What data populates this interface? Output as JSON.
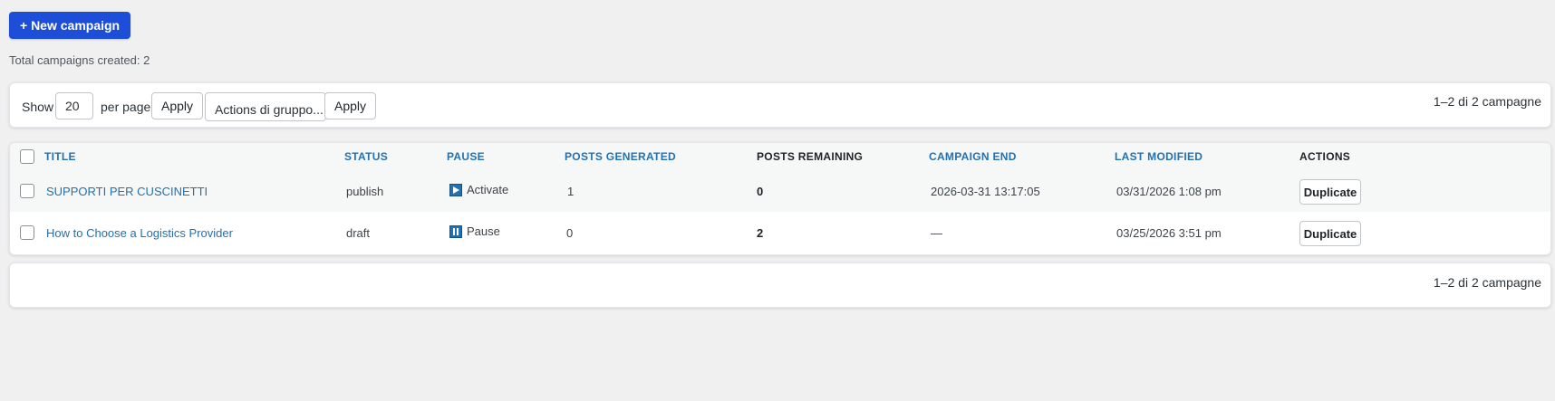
{
  "header": {
    "new_campaign_label": "+ New campaign",
    "total_text": "Total campaigns created: 2"
  },
  "toolbar": {
    "show_label": "Show",
    "per_page_value": "20",
    "per_page_label": "per page",
    "apply_label": "Apply",
    "bulk_actions_label": "Actions di gruppo...",
    "bulk_apply_label": "Apply",
    "page_count": "1–2 di 2 campagne"
  },
  "table": {
    "columns": {
      "title": "TITLE",
      "status": "STATUS",
      "pause": "PAUSE",
      "posts_generated": "POSTS GENERATED",
      "posts_remaining": "POSTS REMAINING",
      "campaign_end": "CAMPAIGN END",
      "last_modified": "LAST MODIFIED",
      "actions": "ACTIONS"
    },
    "rows": [
      {
        "title": "SUPPORTI PER CUSCINETTI",
        "status": "publish",
        "pause_icon": "play-icon",
        "pause_label": "Activate",
        "posts_generated": "1",
        "posts_remaining": "0",
        "campaign_end": "2026-03-31 13:17:05",
        "last_modified": "03/31/2026 1:08 pm",
        "action_label": "Duplicate"
      },
      {
        "title": "How to Choose a Logistics Provider",
        "status": "draft",
        "pause_icon": "pause-icon",
        "pause_label": "Pause",
        "posts_generated": "0",
        "posts_remaining": "2",
        "campaign_end": "—",
        "last_modified": "03/25/2026 3:51 pm",
        "action_label": "Duplicate"
      }
    ]
  },
  "footer": {
    "page_count": "1–2 di 2 campagne"
  },
  "colors": {
    "primary_button": "#1d4ed8",
    "link": "#2271b1",
    "background": "#f0f0f1"
  }
}
